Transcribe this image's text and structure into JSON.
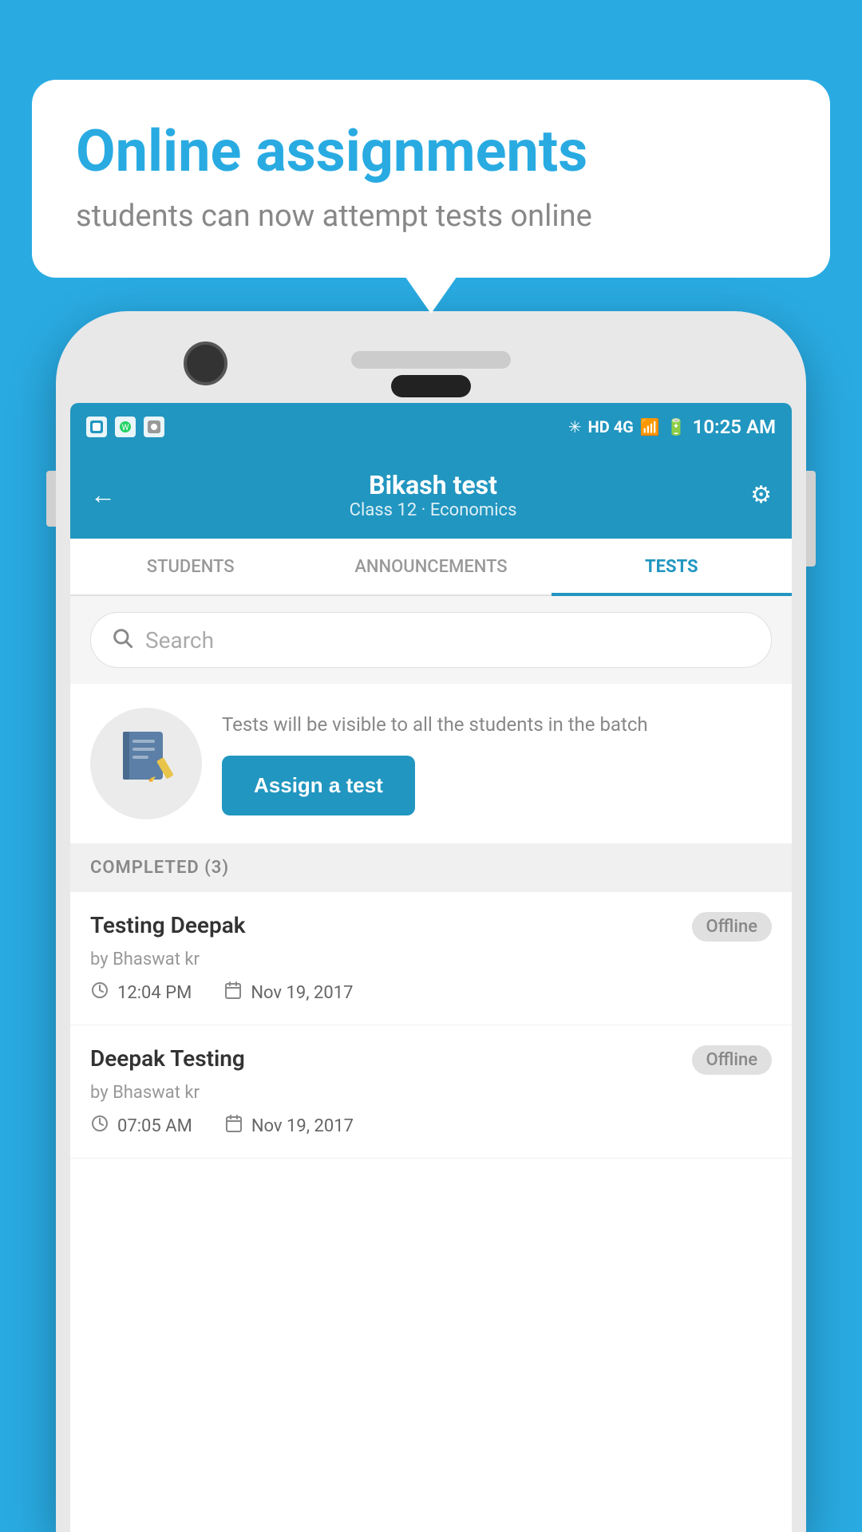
{
  "background": {
    "color": "#29abe2"
  },
  "bubble": {
    "title": "Online assignments",
    "subtitle": "students can now attempt tests online"
  },
  "status_bar": {
    "time": "10:25 AM",
    "network": "HD 4G",
    "icons": [
      "app1",
      "whatsapp",
      "photo"
    ]
  },
  "app_bar": {
    "title": "Bikash test",
    "subtitle": "Class 12 · Economics",
    "back_label": "←",
    "settings_label": "⚙"
  },
  "tabs": [
    {
      "label": "STUDENTS",
      "active": false
    },
    {
      "label": "ANNOUNCEMENTS",
      "active": false
    },
    {
      "label": "TESTS",
      "active": true
    }
  ],
  "search": {
    "placeholder": "Search"
  },
  "assign_section": {
    "description": "Tests will be visible to all the students in the batch",
    "button_label": "Assign a test"
  },
  "completed_section": {
    "header": "COMPLETED (3)"
  },
  "tests": [
    {
      "name": "Testing Deepak",
      "by": "by Bhaswat kr",
      "time": "12:04 PM",
      "date": "Nov 19, 2017",
      "status": "Offline"
    },
    {
      "name": "Deepak Testing",
      "by": "by Bhaswat kr",
      "time": "07:05 AM",
      "date": "Nov 19, 2017",
      "status": "Offline"
    }
  ]
}
